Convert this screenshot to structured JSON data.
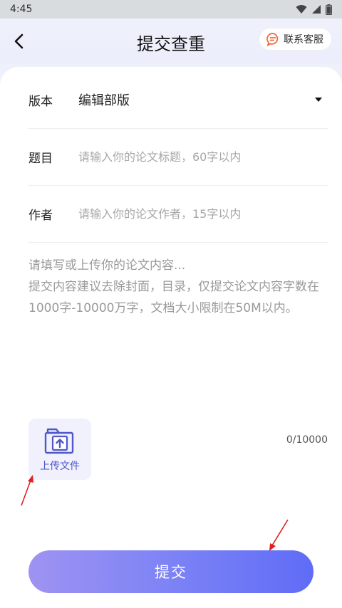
{
  "status_bar": {
    "time": "4:45"
  },
  "header": {
    "title": "提交查重",
    "service_label": "联系客服"
  },
  "form": {
    "version": {
      "label": "版本",
      "value": "编辑部版"
    },
    "subject": {
      "label": "题目",
      "placeholder": "请输入你的论文标题，60字以内"
    },
    "author": {
      "label": "作者",
      "placeholder": "请输入你的论文作者，15字以内"
    },
    "content": {
      "placeholder": "请填写或上传你的论文内容...\n提交内容建议去除封面，目录，仅提交论文内容字数在1000字-10000万字，文档大小限制在50M以内。"
    },
    "upload_label": "上传文件",
    "counter": "0/10000"
  },
  "submit_label": "提交",
  "colors": {
    "accent": "#5f6cf6",
    "accent_light": "#9e93f2",
    "service_icon": "#f06a3a",
    "annotation": "#e02020"
  }
}
